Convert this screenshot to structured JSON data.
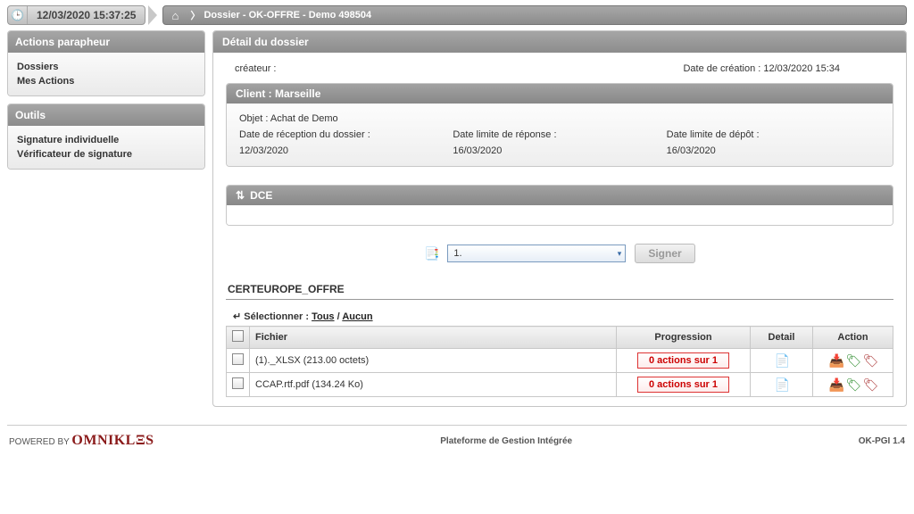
{
  "clock": "12/03/2020 15:37:25",
  "breadcrumb": "Dossier - OK-OFFRE - Demo 498504",
  "sidebar": {
    "section1_title": "Actions parapheur",
    "section1_links": [
      "Dossiers",
      "Mes Actions"
    ],
    "section2_title": "Outils",
    "section2_links": [
      "Signature individuelle",
      "Vérificateur de signature"
    ]
  },
  "main_title": "Détail du dossier",
  "creator_label": "créateur :",
  "creation_label": "Date de création : 12/03/2020 15:34",
  "client_title": "Client : Marseille",
  "objet": "Objet : Achat de Demo",
  "date_reception_label": "Date de réception du dossier :",
  "date_reception_value": "12/03/2020",
  "date_limite_reponse_label": "Date limite de réponse :",
  "date_limite_reponse_value": "16/03/2020",
  "date_limite_depot_label": "Date limite de dépôt :",
  "date_limite_depot_value": "16/03/2020",
  "dce_title": "DCE",
  "select_value": "1.",
  "signer_label": "Signer",
  "offre_title": "CERTEUROPE_OFFRE",
  "selectionner_label": "Sélectionner :",
  "tous": "Tous",
  "aucun": "Aucun",
  "table": {
    "headers": {
      "fichier": "Fichier",
      "progression": "Progression",
      "detail": "Detail",
      "action": "Action"
    },
    "rows": [
      {
        "fichier": "(1)._XLSX (213.00 octets)",
        "progression": "0 actions sur 1"
      },
      {
        "fichier": "CCAP.rtf.pdf (134.24 Ko)",
        "progression": "0 actions sur 1"
      }
    ]
  },
  "footer": {
    "powered_by": "POWERED BY",
    "brand": "OMNIKLΞS",
    "center": "Plateforme de Gestion Intégrée",
    "right": "OK-PGI 1.4"
  }
}
